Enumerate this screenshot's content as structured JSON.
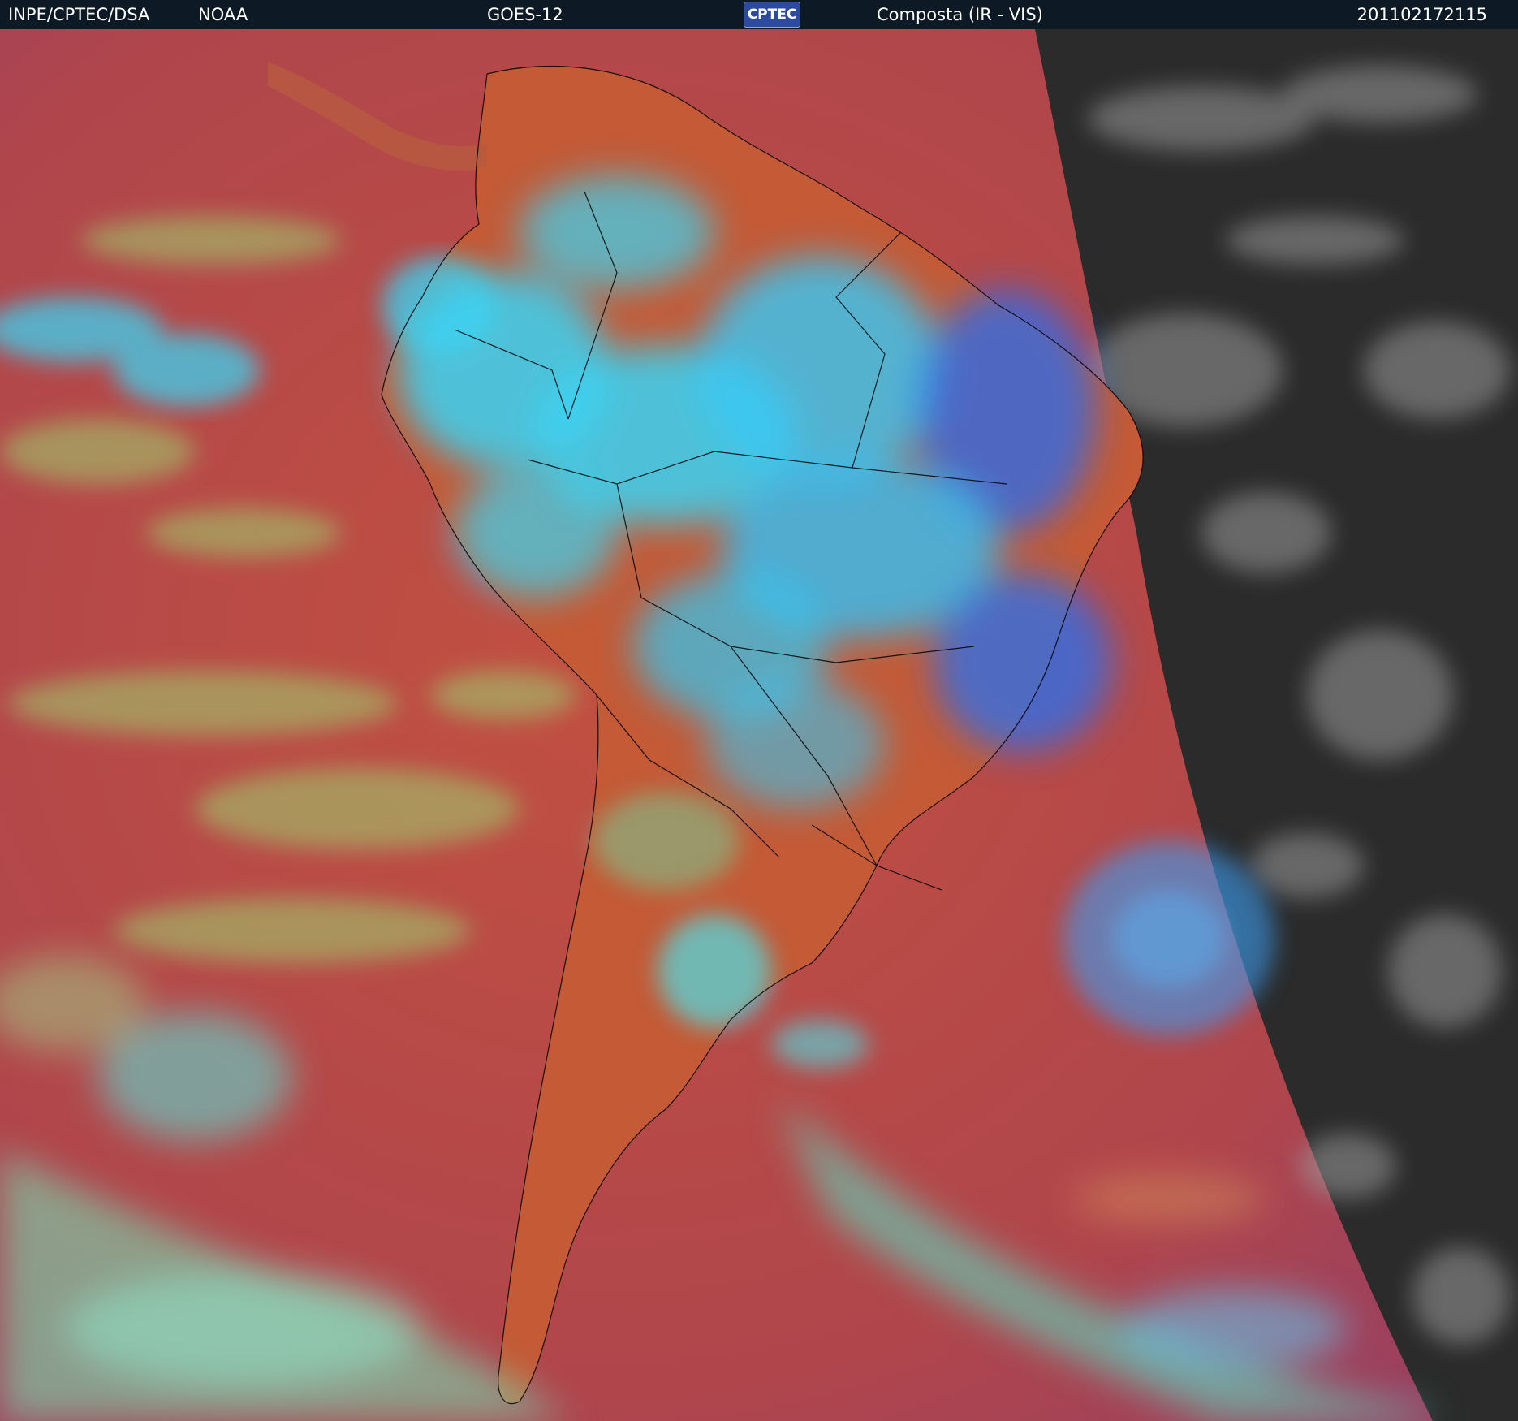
{
  "header": {
    "agency": "INPE/CPTEC/DSA",
    "satellite_org": "NOAA",
    "satellite": "GOES-12",
    "logo_text": "CPTEC",
    "product": "Composta (IR - VIS)",
    "timestamp": "201102172115"
  },
  "image": {
    "description_kind": "satellite-composite",
    "ir_background": "#b24848",
    "land_color": "#c85a32",
    "cold_cloud_color": "#33ccff",
    "deep_convection_color": "#2a6cf0",
    "low_cloud_color": "#8ee07a",
    "night_side_color": "#2a2a2a",
    "border_color": "#000000"
  }
}
